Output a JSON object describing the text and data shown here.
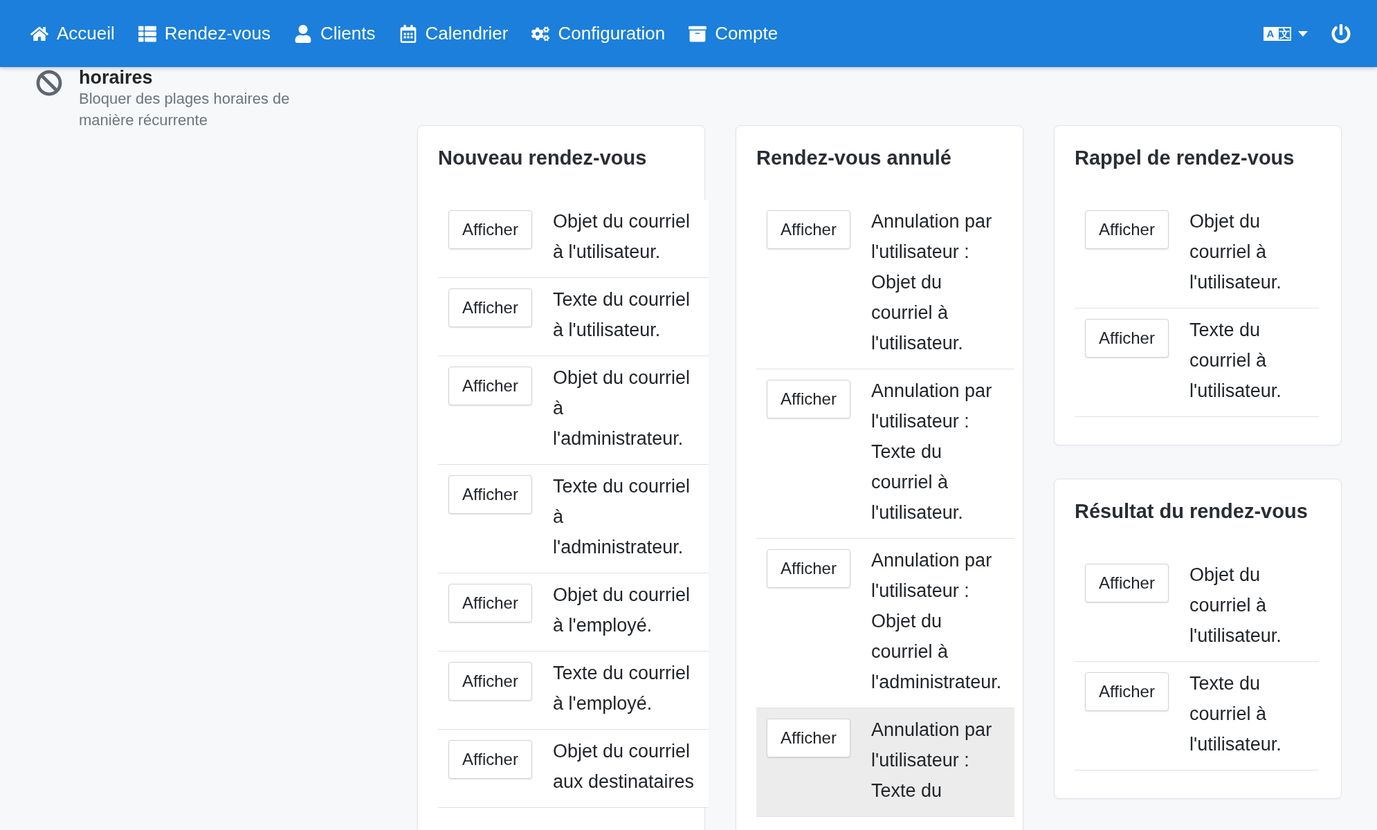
{
  "nav": {
    "items": [
      {
        "label": "Accueil"
      },
      {
        "label": "Rendez-vous"
      },
      {
        "label": "Clients"
      },
      {
        "label": "Calendrier"
      },
      {
        "label": "Configuration"
      },
      {
        "label": "Compte"
      }
    ],
    "language_glyphs": [
      "A",
      "文"
    ]
  },
  "sidebar": {
    "items": [
      {
        "title": "horaires",
        "description": "Bloquer des plages horaires de manière récurrente"
      }
    ]
  },
  "columns": [
    {
      "cards": [
        {
          "title": "Nouveau rendez-vous",
          "rows": [
            {
              "button": "Afficher",
              "text": "Objet du courriel à l'utilisateur.",
              "highlighted": false
            },
            {
              "button": "Afficher",
              "text": "Texte du courriel à l'utilisateur.",
              "highlighted": false
            },
            {
              "button": "Afficher",
              "text": "Objet du courriel à l'administrateur.",
              "highlighted": false
            },
            {
              "button": "Afficher",
              "text": "Texte du courriel à l'administrateur.",
              "highlighted": false
            },
            {
              "button": "Afficher",
              "text": "Objet du courriel à l'employé.",
              "highlighted": false
            },
            {
              "button": "Afficher",
              "text": "Texte du courriel à l'employé.",
              "highlighted": false
            },
            {
              "button": "Afficher",
              "text": "Objet du courriel aux destinataires",
              "highlighted": false
            }
          ]
        }
      ]
    },
    {
      "cards": [
        {
          "title": "Rendez-vous annulé",
          "rows": [
            {
              "button": "Afficher",
              "text": "Annulation par l'utilisateur : Objet du courriel à l'utilisateur.",
              "highlighted": false
            },
            {
              "button": "Afficher",
              "text": "Annulation par l'utilisateur : Texte du courriel à l'utilisateur.",
              "highlighted": false
            },
            {
              "button": "Afficher",
              "text": "Annulation par l'utilisateur : Objet du courriel à l'administrateur.",
              "highlighted": false
            },
            {
              "button": "Afficher",
              "text": "Annulation par l'utilisateur : Texte du",
              "highlighted": true
            }
          ]
        }
      ]
    },
    {
      "cards": [
        {
          "title": "Rappel de rendez-vous",
          "rows": [
            {
              "button": "Afficher",
              "text": "Objet du courriel à l'utilisateur.",
              "highlighted": false
            },
            {
              "button": "Afficher",
              "text": "Texte du courriel à l'utilisateur.",
              "highlighted": false
            }
          ]
        },
        {
          "title": "Résultat du rendez-vous",
          "rows": [
            {
              "button": "Afficher",
              "text": "Objet du courriel à l'utilisateur.",
              "highlighted": false
            },
            {
              "button": "Afficher",
              "text": "Texte du courriel à l'utilisateur.",
              "highlighted": false
            }
          ]
        }
      ]
    }
  ]
}
